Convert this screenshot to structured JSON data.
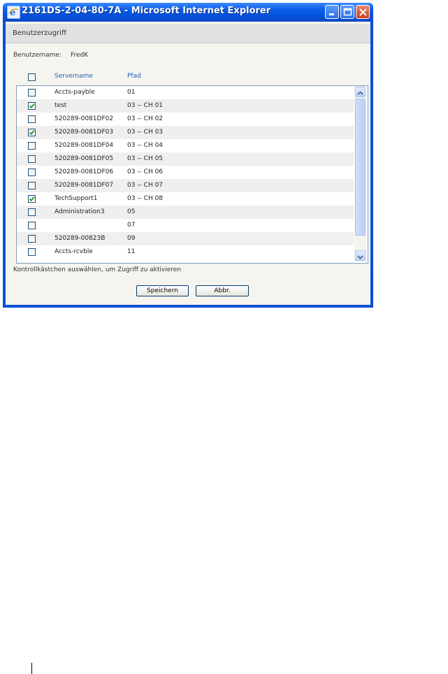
{
  "window": {
    "title": "2161DS-2-04-80-7A - Microsoft Internet Explorer",
    "controls": [
      "minimize-icon",
      "maximize-icon",
      "close-icon"
    ]
  },
  "dialog": {
    "heading": "Benutzerzugriff",
    "username_label": "Benutzername:",
    "username_value": "FredK",
    "columns": {
      "server": "Servername",
      "path": "Pfad"
    },
    "select_all_checked": false,
    "rows": [
      {
        "server": "Accts-payble",
        "path": "01",
        "checked": false
      },
      {
        "server": "test",
        "path": "03 -- CH 01",
        "checked": true
      },
      {
        "server": "520289-0081DF02",
        "path": "03 -- CH 02",
        "checked": false
      },
      {
        "server": "520289-0081DF03",
        "path": "03 -- CH 03",
        "checked": true
      },
      {
        "server": "520289-0081DF04",
        "path": "03 -- CH 04",
        "checked": false
      },
      {
        "server": "520289-0081DF05",
        "path": "03 -- CH 05",
        "checked": false
      },
      {
        "server": "520289-0081DF06",
        "path": "03 -- CH 06",
        "checked": false
      },
      {
        "server": "520289-0081DF07",
        "path": "03 -- CH 07",
        "checked": false
      },
      {
        "server": "TechSupport1",
        "path": "03 -- CH 08",
        "checked": true
      },
      {
        "server": "Administration3",
        "path": "05",
        "checked": false
      },
      {
        "server": "",
        "path": "07",
        "checked": false
      },
      {
        "server": "520289-00823B",
        "path": "09",
        "checked": false
      },
      {
        "server": "Accts-rcvble",
        "path": "11",
        "checked": false
      }
    ],
    "hint": "Kontrollkästchen auswählen, um Zugriff zu aktivieren",
    "save_label": "Speichern",
    "cancel_label": "Abbr."
  },
  "colors": {
    "title_bar": "#0450dc",
    "header_text": "#1f5fbf",
    "check": "#1a9a1a"
  }
}
